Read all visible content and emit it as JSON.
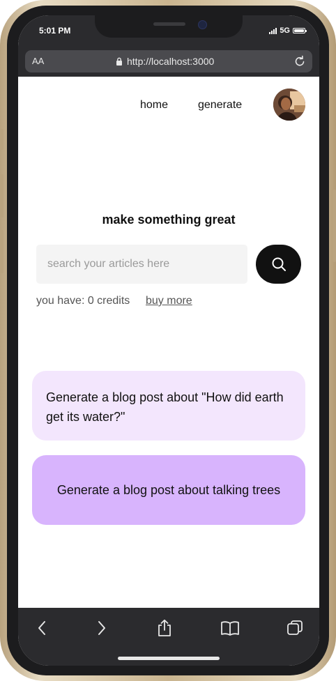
{
  "status": {
    "time": "5:01 PM",
    "network": "5G"
  },
  "browser": {
    "text_size_label": "AA",
    "url": "http://localhost:3000"
  },
  "nav": {
    "home": "home",
    "generate": "generate"
  },
  "main": {
    "heading": "make something great",
    "search_placeholder": "search your articles here",
    "credits_text": "you have: 0 credits",
    "buy_more": "buy more"
  },
  "suggestions": [
    {
      "text": "Generate a blog post about \"How did earth get its water?\""
    },
    {
      "text": "Generate a blog post about talking trees"
    }
  ],
  "colors": {
    "card_light": "#f3e6fd",
    "card_dark": "#d8b4fd",
    "button": "#111111"
  }
}
